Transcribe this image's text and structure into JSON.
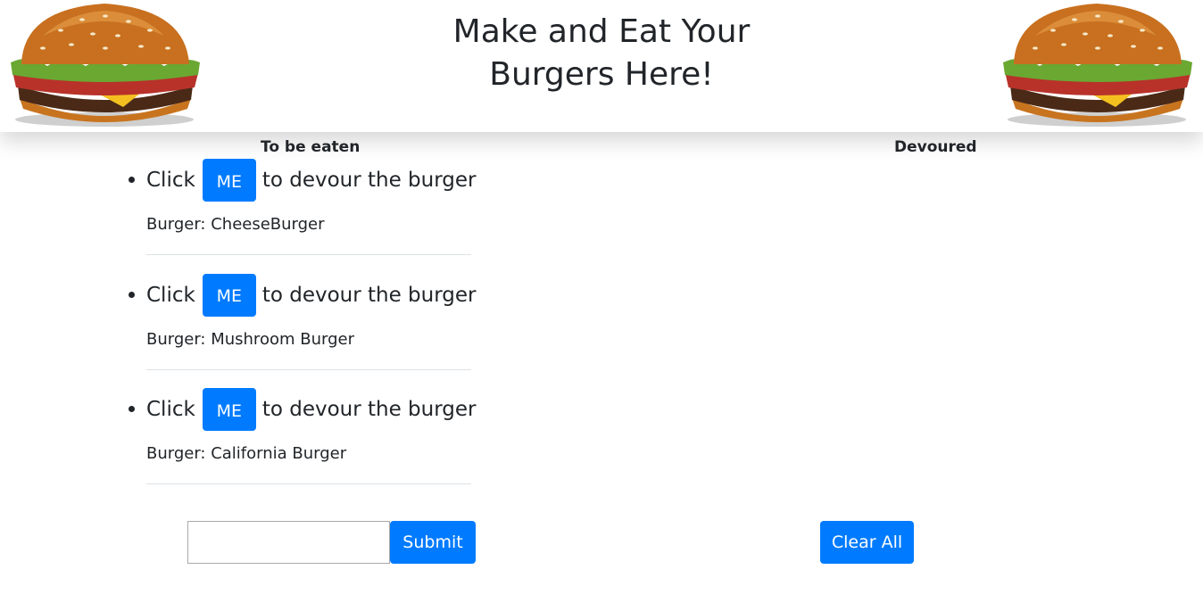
{
  "header": {
    "title": "Make and Eat Your Burgers Here!"
  },
  "columns": {
    "left_heading": "To be eaten",
    "right_heading": "Devoured"
  },
  "to_be_eaten": [
    {
      "prefix": "Click",
      "button": "ME",
      "suffix": "to devour the burger",
      "name": "Burger: CheeseBurger"
    },
    {
      "prefix": "Click",
      "button": "ME",
      "suffix": "to devour the burger",
      "name": "Burger: Mushroom Burger"
    },
    {
      "prefix": "Click",
      "button": "ME",
      "suffix": "to devour the burger",
      "name": "Burger: California Burger"
    }
  ],
  "form": {
    "input_value": "",
    "submit_label": "Submit"
  },
  "devoured": {
    "clear_label": "Clear All"
  },
  "colors": {
    "primary": "#007bff",
    "text": "#212529",
    "divider": "#dee2e6"
  },
  "icons": [
    "burger-image-left",
    "burger-image-right"
  ]
}
